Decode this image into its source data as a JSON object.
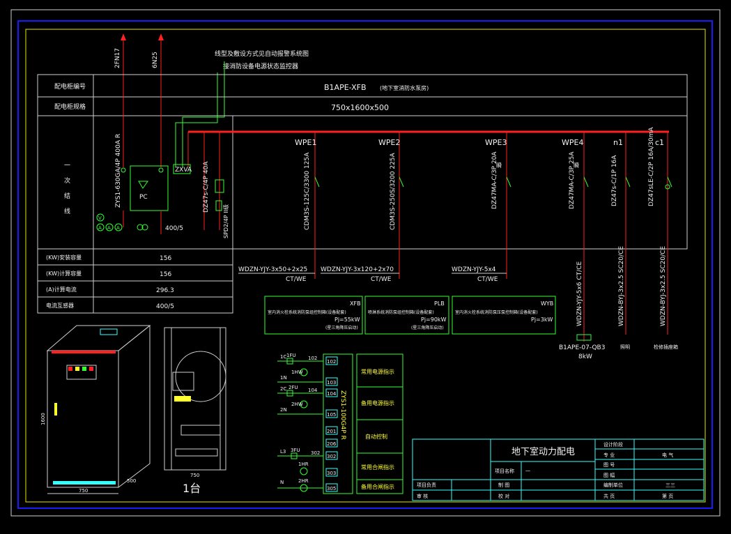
{
  "colors": {
    "background": "#000000",
    "border_blue": "#1a1aff",
    "frame_yellow": "#e6e600",
    "busbar_red": "#ff2020",
    "green": "#33ff33",
    "cyan": "#33ffff"
  },
  "feeders_top": {
    "left": "2FN17",
    "right": "6N25"
  },
  "notes": {
    "line1": "线型及敷设方式见自动报警系统图",
    "line2": "接消防设备电源状态监控器"
  },
  "table": {
    "row1_label": "配电柜编号",
    "row1_value": "B1APE-XFB",
    "row1_sub": "(地下室消防水泵房)",
    "row2_label": "配电柜规格",
    "row2_value": "750x1600x500",
    "row3_label": [
      "一",
      "次",
      "结",
      "线"
    ]
  },
  "incoming": {
    "breaker": "ZYS1-630GA/4P 400A R",
    "zxva": "ZXVA",
    "pc": "PC",
    "ct": "400/5",
    "meters": [
      "V",
      "A",
      "A",
      "A"
    ],
    "spd_breaker": "DZ47s-C/4P 40A",
    "spd": "SPD2/4P II级"
  },
  "branches": [
    {
      "id": "WPE1",
      "breaker": "CDM3S-125C/3300 125A"
    },
    {
      "id": "WPE2",
      "breaker": "CDM3S-250S/3200 225A"
    },
    {
      "id": "WPE3",
      "breaker": "DZ47MA-C/3P 20A",
      "tag": "瞬"
    },
    {
      "id": "WPE4",
      "breaker": "DZ47MA-C/3P 25A",
      "tag": "瞬"
    },
    {
      "id": "n1",
      "breaker": "DZ47s-C/1P 16A"
    },
    {
      "id": "c1",
      "breaker": "DZ47sLE-C/2P 16A/30mA"
    }
  ],
  "params": [
    {
      "label": "(KW)安装容量",
      "value": "156"
    },
    {
      "label": "(KW)计算容量",
      "value": "156"
    },
    {
      "label": "(A)计算电流",
      "value": "296.3"
    },
    {
      "label": "电流互感器",
      "value": "400/5"
    }
  ],
  "cables": {
    "c1": "WDZN-YJY-3x50+2x25",
    "c1b": "CT/WE",
    "c2": "WDZN-YJY-3x120+2x70",
    "c2b": "CT/WE",
    "c3": "WDZN-YJY-5x4",
    "c3b": "CT/WE",
    "v4": "WDZN-YJY-5x6 CT/CE",
    "v5": "WDZN-BYJ-3x2.5 SC20/CE",
    "v6": "WDZN-BYJ-3x2.5 SC20/CE"
  },
  "loads": [
    {
      "code": "XFB",
      "desc": "室内消火栓系统消防泵组控制箱(设备配套)",
      "pj": "Pj=55kW",
      "note": "(星三角降压启动)"
    },
    {
      "code": "PLB",
      "desc": "喷淋系统消防泵组控制箱(设备配套)",
      "pj": "Pj=90kW",
      "note": "(星三角降压启动)"
    },
    {
      "code": "WYB",
      "desc": "室内消火栓系统消防泵压泵控制箱(设备配套)",
      "pj": "Pj=3kW",
      "note": ""
    }
  ],
  "load4": {
    "name": "B1APE-07-QB3",
    "kw": "8kW"
  },
  "load5": "照明",
  "load6": "检修插座箱",
  "control": {
    "device": "ZYS1-100G4P R",
    "rows": [
      {
        "wire": "1C",
        "fu": "1FU",
        "num1": "102",
        "num2": "102"
      },
      {
        "wire": "1N",
        "num2": "103"
      },
      {
        "wire": "2C",
        "fu": "2FU",
        "num1": "104",
        "num2": "104"
      },
      {
        "wire": "2N",
        "num2": "105"
      },
      {
        "num2": "201"
      },
      {
        "num2": "206"
      },
      {
        "wire": "L3",
        "fu": "3FU",
        "num1": "302",
        "num2": "302"
      },
      {
        "num2": "303"
      },
      {
        "wire": "N",
        "num2": "305"
      }
    ],
    "lamps": [
      "1HW",
      "2HW",
      "1HR",
      "2HR"
    ],
    "labels": [
      "常用电源指示",
      "备用电源指示",
      "自动控制",
      "常用合闸指示",
      "备用合闸指示"
    ]
  },
  "cabinet": {
    "width": "750",
    "depth": "500",
    "height": "1600",
    "side_width": "750",
    "quantity": "1台"
  },
  "title_block": {
    "title": "地下室动力配电",
    "design_stage": "设计阶段",
    "discipline_label": "专 业",
    "discipline": "电 气",
    "drawing_no": "图 号",
    "scale": "图 幅",
    "project_name_label": "项目名称",
    "project_name": "一",
    "owner": "项目负责",
    "draw": "制 图",
    "check": "审 核",
    "review": "校 对",
    "unit_label": "编制单位",
    "unit": "三三",
    "total": "共 页",
    "page": "第 页"
  }
}
